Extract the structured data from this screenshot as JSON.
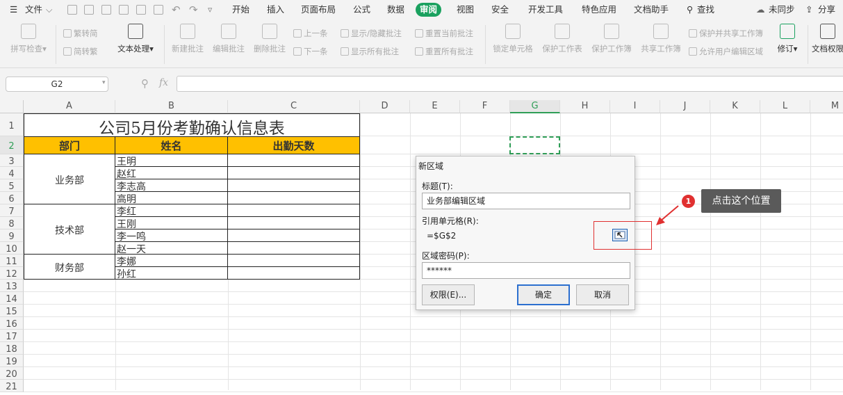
{
  "menu": {
    "file": "文件",
    "tabs": [
      "开始",
      "插入",
      "页面布局",
      "公式",
      "数据",
      "审阅",
      "视图",
      "安全",
      "开发工具",
      "特色应用",
      "文档助手"
    ],
    "search": "查找",
    "sync": "未同步",
    "share": "分享"
  },
  "ribbon": {
    "spellcheck": "拼写检查",
    "trad_to_simp": "繁转简",
    "simp_to_trad": "简转繁",
    "text_process": "文本处理",
    "new_comment": "新建批注",
    "edit_comment": "编辑批注",
    "delete_comment": "删除批注",
    "prev": "上一条",
    "next": "下一条",
    "show_hide_comment": "显示/隐藏批注",
    "show_all_comments": "显示所有批注",
    "reset_current_comment": "重置当前批注",
    "reset_all_comments": "重置所有批注",
    "lock_cell": "锁定单元格",
    "protect_sheet": "保护工作表",
    "protect_book": "保护工作簿",
    "share_book": "共享工作簿",
    "protect_share_book": "保护并共享工作簿",
    "allow_edit_ranges": "允许用户编辑区域",
    "track_changes": "修订",
    "doc_permissions": "文档权限"
  },
  "formula_bar": {
    "name_box": "G2",
    "fx": "fx",
    "value": ""
  },
  "columns": [
    "A",
    "B",
    "C",
    "D",
    "E",
    "F",
    "G",
    "H",
    "I",
    "J",
    "K",
    "L",
    "M"
  ],
  "rows": [
    "1",
    "2",
    "3",
    "4",
    "5",
    "6",
    "7",
    "8",
    "9",
    "10",
    "11",
    "12",
    "13",
    "14",
    "15",
    "16",
    "17",
    "18",
    "19",
    "20",
    "21"
  ],
  "sheet": {
    "title": "公司5月份考勤确认信息表",
    "headers": [
      "部门",
      "姓名",
      "出勤天数"
    ],
    "depts": [
      "业务部",
      "技术部",
      "财务部"
    ],
    "names": [
      "王明",
      "赵红",
      "李志高",
      "高明",
      "李红",
      "王刚",
      "李一鸣",
      "赵一天",
      "李娜",
      "孙红"
    ]
  },
  "dialog": {
    "title": "新区域",
    "title_label": "标题(T):",
    "title_value": "业务部编辑区域",
    "ref_label": "引用单元格(R):",
    "ref_value": "=$G$2",
    "pwd_label": "区域密码(P):",
    "pwd_value": "******",
    "perm_button": "权限(E)...",
    "ok_button": "确定",
    "cancel_button": "取消"
  },
  "annotation": {
    "badge": "1",
    "text": "点击这个位置"
  },
  "colors": {
    "accent": "#1aa15f",
    "header_fill": "#ffc000",
    "callout_red": "#e03030",
    "selection": "#2f9e57"
  }
}
